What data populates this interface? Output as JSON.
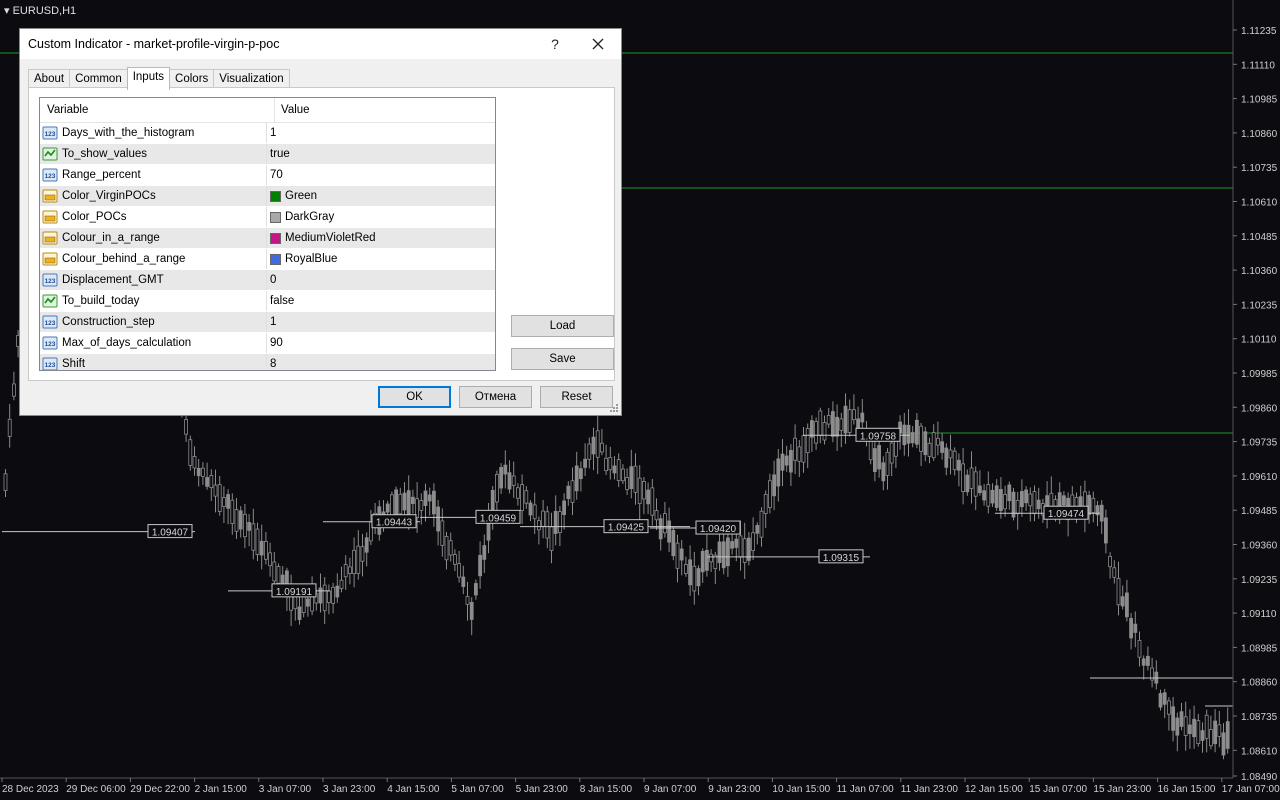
{
  "window": {
    "symbol": "EURUSD,H1"
  },
  "dialog": {
    "title": "Custom Indicator - market-profile-virgin-p-poc",
    "help_glyph": "?",
    "tabs": [
      {
        "label": "About"
      },
      {
        "label": "Common"
      },
      {
        "label": "Inputs"
      },
      {
        "label": "Colors"
      },
      {
        "label": "Visualization"
      }
    ],
    "active_tab": "Inputs",
    "grid": {
      "col_variable": "Variable",
      "col_value": "Value",
      "rows": [
        {
          "name": "Days_with_the_histogram",
          "value": "1",
          "type_icon": "integer-icon"
        },
        {
          "name": "To_show_values",
          "value": "true",
          "type_icon": "boolean-icon"
        },
        {
          "name": "Range_percent",
          "value": "70",
          "type_icon": "integer-icon"
        },
        {
          "name": "Color_VirginPOCs",
          "value": "Green",
          "type_icon": "color-icon",
          "swatch": "#008000"
        },
        {
          "name": "Color_POCs",
          "value": "DarkGray",
          "type_icon": "color-icon",
          "swatch": "#a9a9a9"
        },
        {
          "name": "Colour_in_a_range",
          "value": "MediumVioletRed",
          "type_icon": "color-icon",
          "swatch": "#c71585"
        },
        {
          "name": "Colour_behind_a_range",
          "value": "RoyalBlue",
          "type_icon": "color-icon",
          "swatch": "#4169e1"
        },
        {
          "name": "Displacement_GMT",
          "value": "0",
          "type_icon": "integer-icon"
        },
        {
          "name": "To_build_today",
          "value": "false",
          "type_icon": "boolean-icon"
        },
        {
          "name": "Construction_step",
          "value": "1",
          "type_icon": "integer-icon"
        },
        {
          "name": "Max_of_days_calculation",
          "value": "90",
          "type_icon": "integer-icon"
        },
        {
          "name": "Shift",
          "value": "8",
          "type_icon": "integer-icon"
        }
      ]
    },
    "buttons": {
      "load": "Load",
      "save": "Save",
      "ok": "OK",
      "cancel": "Отмена",
      "reset": "Reset"
    }
  },
  "chart": {
    "price_axis": [
      "1.11235",
      "1.11110",
      "1.10985",
      "1.10860",
      "1.10735",
      "1.10610",
      "1.10485",
      "1.10360",
      "1.10235",
      "1.10110",
      "1.09985",
      "1.09860",
      "1.09735",
      "1.09610",
      "1.09485",
      "1.09360",
      "1.09235",
      "1.09110",
      "1.08985",
      "1.08860",
      "1.08735",
      "1.08610",
      "1.08490"
    ],
    "time_axis": [
      "28 Dec 2023",
      "29 Dec 06:00",
      "29 Dec 22:00",
      "2 Jan 15:00",
      "3 Jan 07:00",
      "3 Jan 23:00",
      "4 Jan 15:00",
      "5 Jan 07:00",
      "5 Jan 23:00",
      "8 Jan 15:00",
      "9 Jan 07:00",
      "9 Jan 23:00",
      "10 Jan 15:00",
      "11 Jan 07:00",
      "11 Jan 23:00",
      "12 Jan 15:00",
      "15 Jan 07:00",
      "15 Jan 23:00",
      "16 Jan 15:00",
      "17 Jan 07:00"
    ],
    "poc_labels": [
      "1.09407",
      "1.09191",
      "1.09443",
      "1.09459",
      "1.09425",
      "1.09420",
      "1.09315",
      "1.09758",
      "1.09474"
    ],
    "colors": {
      "background": "#0b0b10",
      "candle": "#8c8c8c",
      "virgin_poc": "#1f9a2a",
      "poc": "#c8c8c8",
      "axis_text": "#d0d0d0"
    }
  }
}
